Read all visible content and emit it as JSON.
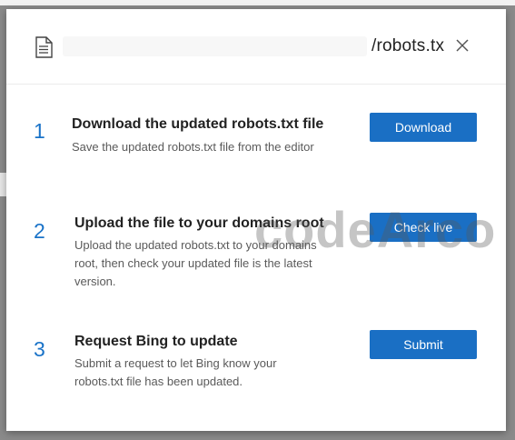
{
  "dialog": {
    "title_visible": "/robots.tx",
    "icons": {
      "file": "document-icon",
      "close": "close-icon"
    }
  },
  "steps": [
    {
      "number": "1",
      "title": "Download the updated robots.txt file",
      "description": "Save the updated robots.txt file from the editor",
      "button_label": "Download"
    },
    {
      "number": "2",
      "title": "Upload the file to your domains root",
      "description": "Upload the updated robots.txt to your domains root, then check your updated file is the latest version.",
      "button_label": "Check live"
    },
    {
      "number": "3",
      "title": "Request Bing to update",
      "description": "Submit a request to let Bing know your robots.txt file has been updated.",
      "button_label": "Submit"
    }
  ],
  "watermark": "codeArco",
  "colors": {
    "accent": "#1a73c8",
    "button": "#1a6fc4",
    "overlay": "#8a8a8a"
  }
}
